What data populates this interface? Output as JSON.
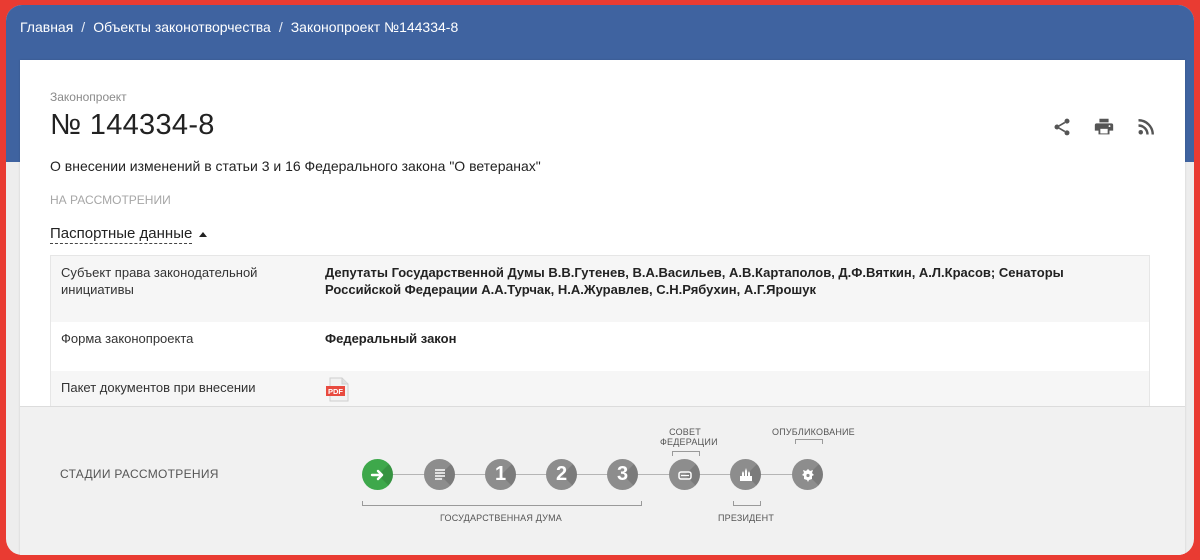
{
  "breadcrumb": {
    "items": [
      "Главная",
      "Объекты законотворчества",
      "Законопроект №144334-8"
    ],
    "separator": "/"
  },
  "bill": {
    "kind": "Законопроект",
    "number": "№ 144334-8",
    "title": "О внесении изменений в статьи 3 и 16 Федерального закона \"О ветеранах\"",
    "status": "НА РАССМОТРЕНИИ"
  },
  "actions": {
    "share_icon": "share-icon",
    "print_icon": "print-icon",
    "rss_icon": "rss-icon"
  },
  "passport": {
    "toggle_label": "Паспортные данные",
    "rows": [
      {
        "key": "Субъект права законодательной инициативы",
        "value": "Депутаты Государственной Думы В.В.Гутенев, В.А.Васильев, А.В.Картаполов, Д.Ф.Вяткин, А.Л.Красов; Сенаторы Российской Федерации А.А.Турчак, Н.А.Журавлев, С.Н.Рябухин, А.Г.Ярошук"
      },
      {
        "key": "Форма законопроекта",
        "value": "Федеральный закон"
      },
      {
        "key": "Пакет документов при внесении",
        "value": "PDF"
      }
    ]
  },
  "stages": {
    "title": "СТАДИИ РАССМОТРЕНИЯ",
    "items": [
      {
        "name": "arrow-right-icon",
        "active": true
      },
      {
        "name": "document-list-icon",
        "active": false
      },
      {
        "name": "reading-1",
        "label": "1",
        "active": false
      },
      {
        "name": "reading-2",
        "label": "2",
        "active": false
      },
      {
        "name": "reading-3",
        "label": "3",
        "active": false
      },
      {
        "name": "federation-council-icon",
        "active": false
      },
      {
        "name": "kremlin-icon",
        "active": false
      },
      {
        "name": "emblem-icon",
        "active": false
      }
    ],
    "labels": {
      "duma": "ГОСУДАРСТВЕННАЯ ДУМА",
      "council_line1": "СОВЕТ",
      "council_line2": "ФЕДЕРАЦИИ",
      "president": "ПРЕЗИДЕНТ",
      "publication": "ОПУБЛИКОВАНИЕ"
    }
  },
  "colors": {
    "header": "#3f63a0",
    "frame": "#e93b32",
    "active_stage": "#3ea84b",
    "stage": "#8d8d8d",
    "pdf": "#e84a3f"
  }
}
